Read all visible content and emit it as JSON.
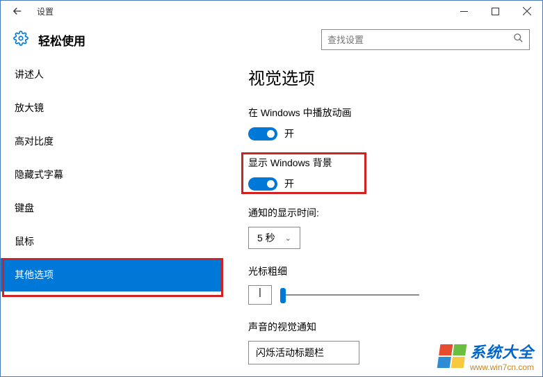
{
  "titlebar": {
    "title": "设置"
  },
  "header": {
    "category": "轻松使用",
    "search_placeholder": "查找设置"
  },
  "sidebar": {
    "items": [
      {
        "label": "讲述人"
      },
      {
        "label": "放大镜"
      },
      {
        "label": "高对比度"
      },
      {
        "label": "隐藏式字幕"
      },
      {
        "label": "键盘"
      },
      {
        "label": "鼠标"
      },
      {
        "label": "其他选项"
      }
    ]
  },
  "main": {
    "heading": "视觉选项",
    "animations": {
      "label": "在 Windows 中播放动画",
      "state": "开"
    },
    "background": {
      "label": "显示 Windows 背景",
      "state": "开"
    },
    "notification": {
      "label": "通知的显示时间:",
      "value": "5 秒"
    },
    "cursor": {
      "label": "光标粗细",
      "value": "|"
    },
    "sound_notify": {
      "label": "声音的视觉通知",
      "value": "闪烁活动标题栏"
    }
  },
  "watermark": {
    "title": "系统大全",
    "url": "www.win7cn.com"
  }
}
